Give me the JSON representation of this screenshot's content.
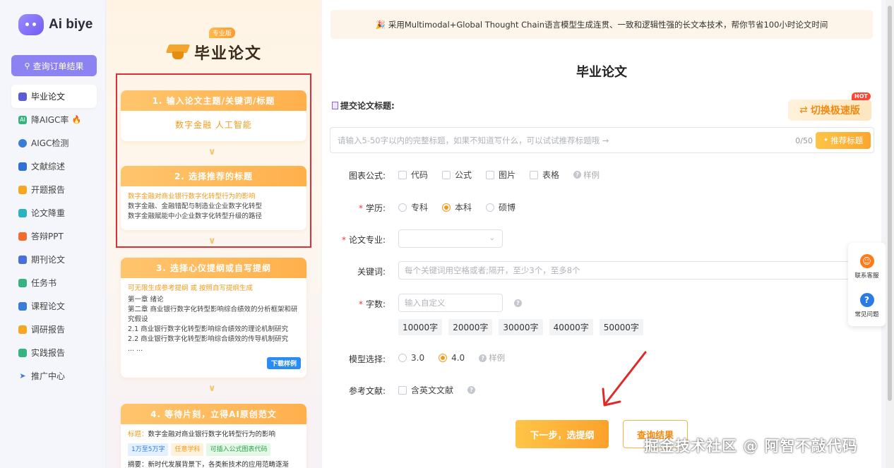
{
  "app": {
    "logo_text": "Ai biye",
    "query_button": "查询订单结果"
  },
  "sidebar": {
    "items": [
      {
        "label": "毕业论文",
        "icon": "graduation-cap-icon",
        "color": "#5b5bd6"
      },
      {
        "label": "降AIGC率",
        "icon": "ai-badge-icon",
        "color": "#36b37e"
      },
      {
        "label": "AIGC检测",
        "icon": "ai-detect-icon",
        "color": "#3a7bd5"
      },
      {
        "label": "文献综述",
        "icon": "book-icon",
        "color": "#2f6fd6"
      },
      {
        "label": "开题报告",
        "icon": "report-icon",
        "color": "#f5a623"
      },
      {
        "label": "论文降重",
        "icon": "refresh-icon",
        "color": "#2bb3c0"
      },
      {
        "label": "答辩PPT",
        "icon": "ppt-icon",
        "color": "#f06d2d"
      },
      {
        "label": "期刊论文",
        "icon": "journal-icon",
        "color": "#4a6fd8"
      },
      {
        "label": "任务书",
        "icon": "task-icon",
        "color": "#36b37e"
      },
      {
        "label": "课程论文",
        "icon": "course-icon",
        "color": "#3a7bd5"
      },
      {
        "label": "调研报告",
        "icon": "survey-icon",
        "color": "#f5a623"
      },
      {
        "label": "实践报告",
        "icon": "practice-icon",
        "color": "#36b37e"
      },
      {
        "label": "推广中心",
        "icon": "send-icon",
        "color": "#3a7bd5"
      }
    ]
  },
  "promo": {
    "tag": "专业版",
    "title": "毕业论文",
    "step1": {
      "head": "1. 输入论文主题/关键词/标题",
      "body": "数字金融 人工智能"
    },
    "step2": {
      "head": "2. 选择推荐的标题",
      "lines": [
        "数字金融对商业银行数字化转型行为的影响",
        "数字金融、金融错配与制造业企业数字化转型",
        "数字金融赋能中小企业数字化转型升级的路径"
      ]
    },
    "step3": {
      "head": "3. 选择心仪提纲或自写提纲",
      "hint": "可无限生成参考提纲 或 按照自写提纲生成",
      "lines": [
        "第一章  绪论",
        "第二章  商业银行数字化转型影响综合绩效的分析框架和研究假设",
        "2.1 商业银行数字化转型影响综合绩效的理论机制研究",
        "2.2 商业银行数字化转型影响综合绩效的传导机制研究",
        "... ..."
      ],
      "download": "下载样例"
    },
    "step4": {
      "head": "4. 等待片刻，立得AI原创范文",
      "title_key": "标题：",
      "title_val": "数字金融对商业银行数字化转型行为的影响",
      "chips": [
        "1万至5万字",
        "任意学科",
        "可插入公式图表代码"
      ],
      "abstract": "摘要：新时代发展背景下，各类新技术的应用范畴逐渐"
    }
  },
  "main": {
    "banner": "采用Multimodal+Global Thought Chain语言模型生成连贯、一致和逻辑性强的长文本技术，帮你节省100小时论文时间",
    "title": "毕业论文",
    "submit_label": "提交论文标题:",
    "speed_button": "切换极速版",
    "hot_badge": "HOT",
    "title_placeholder": "请输入5-50字以内的完整标题，如果不知道写什么，可以试试推荐标题哦 →",
    "title_counter": "0/50",
    "recommend_button": "推荐标题",
    "charts": {
      "label": "图表公式:",
      "options": [
        "代码",
        "公式",
        "图片",
        "表格"
      ],
      "sample": "样例"
    },
    "degree": {
      "label": "学历:",
      "options": [
        "专科",
        "本科",
        "硕博"
      ],
      "selected": "本科"
    },
    "major": {
      "label": "论文专业:"
    },
    "keywords": {
      "label": "关键词:",
      "placeholder": "每个关键词用空格或者;隔开，至少3个，至多8个"
    },
    "wordcount": {
      "label": "字数:",
      "placeholder": "输入自定义",
      "presets": [
        "10000字",
        "20000字",
        "30000字",
        "40000字",
        "50000字"
      ]
    },
    "model": {
      "label": "模型选择:",
      "options": [
        "3.0",
        "4.0"
      ],
      "selected": "4.0",
      "sample": "样例"
    },
    "references": {
      "label": "参考文献:",
      "option": "含英文文献"
    },
    "next_button": "下一步，选提纲",
    "result_button": "查询结果"
  },
  "float": {
    "service": "联系客服",
    "faq": "常见问题"
  },
  "watermark": "掘金技术社区 @ 阿智不敲代码"
}
